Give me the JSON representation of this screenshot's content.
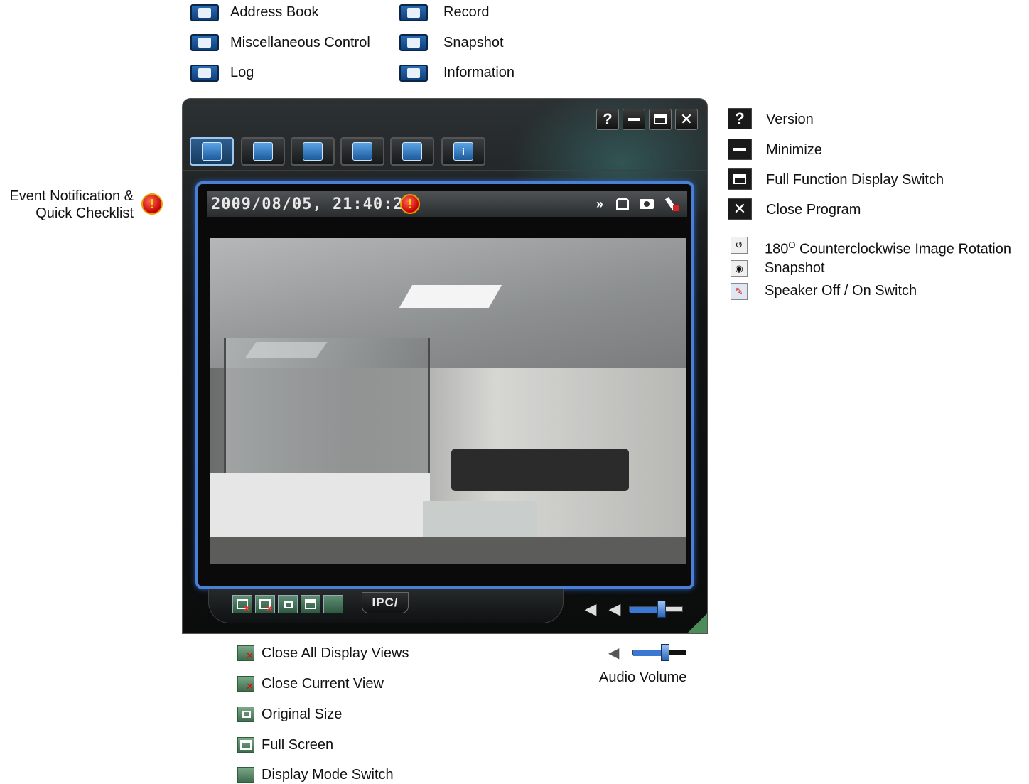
{
  "legend_top": {
    "address_book": "Address Book",
    "misc_control": "Miscellaneous Control",
    "log": "Log",
    "record": "Record",
    "snapshot": "Snapshot",
    "information": "Information"
  },
  "legend_left": {
    "event_line1": "Event Notification &",
    "event_line2": "Quick Checklist"
  },
  "legend_right": {
    "version": "Version",
    "minimize": "Minimize",
    "full_function": "Full Function Display Switch",
    "close_program": "Close Program",
    "rotation_prefix": "180",
    "rotation_sup": "O",
    "rotation_suffix": " Counterclockwise Image Rotation",
    "snapshot": "Snapshot",
    "speaker": "Speaker Off / On Switch"
  },
  "legend_bottom": {
    "close_all": "Close All Display Views",
    "close_current": "Close Current View",
    "original_size": "Original Size",
    "full_screen": "Full Screen",
    "display_mode": "Display Mode Switch",
    "audio_volume": "Audio Volume"
  },
  "window": {
    "title_buttons": {
      "version": "?",
      "close": "✕"
    },
    "timestamp": "2009/08/05, 21:40:20",
    "ipc_label": "IPC/",
    "volume_level": 0.6
  },
  "icons": {
    "warning": "!",
    "forward": "»",
    "info": "i"
  },
  "colors": {
    "frame_blue": "#4a7fd6",
    "tab_blue": "#1d5a9c",
    "warning_red": "#c40000",
    "control_green": "#3f6d4e"
  }
}
